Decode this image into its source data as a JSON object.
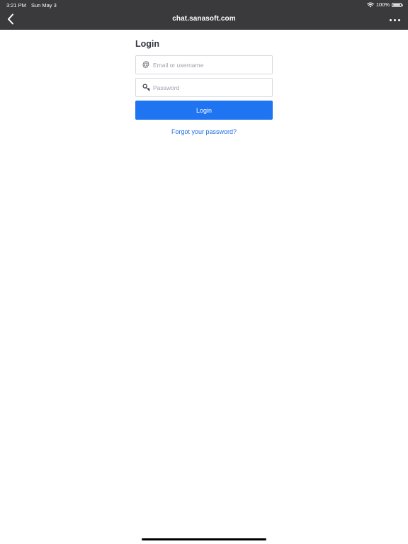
{
  "status_bar": {
    "time": "3:21 PM",
    "date": "Sun May 3",
    "battery": "100%",
    "icons": [
      "wifi-icon",
      "battery-icon"
    ]
  },
  "nav": {
    "title": "chat.sanasoft.com",
    "back_icon": "chevron-left-icon",
    "more_icon": "more-horizontal-icon"
  },
  "login": {
    "title": "Login",
    "email_icon": "@",
    "email_placeholder": "Email or username",
    "email_value": "",
    "password_icon": "key-icon",
    "password_placeholder": "Password",
    "password_value": "",
    "button_label": "Login",
    "forgot_label": "Forgot your password?"
  },
  "colors": {
    "topbar": "#3a3a3c",
    "primary": "#1f74f2",
    "link": "#1f6fe0",
    "title": "#2f3440"
  }
}
